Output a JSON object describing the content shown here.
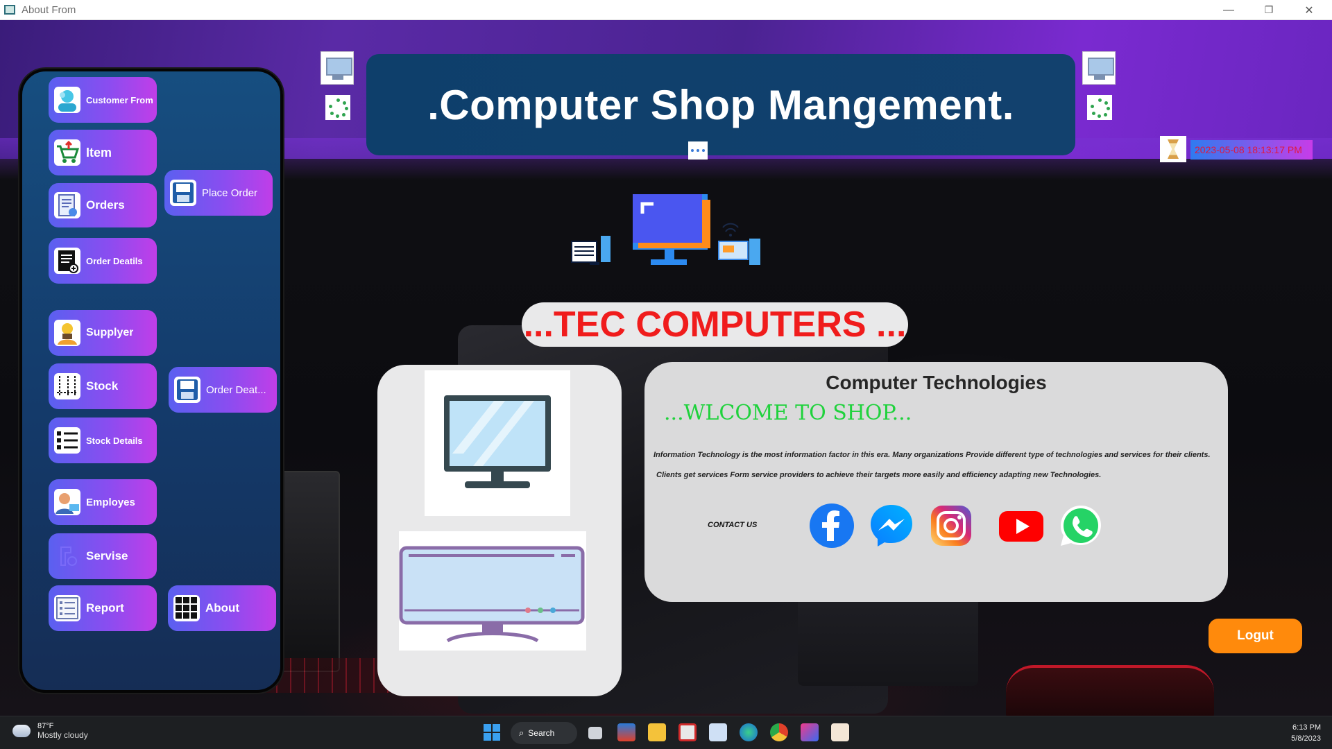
{
  "window": {
    "title": "About From",
    "controls": {
      "minimize": "—",
      "restore": "❐",
      "close": "✕"
    }
  },
  "sidebar": {
    "buttons": [
      {
        "id": "customer",
        "label": "Customer From",
        "icon": "customer-icon"
      },
      {
        "id": "item",
        "label": "Item",
        "icon": "cart-icon"
      },
      {
        "id": "orders",
        "label": "Orders",
        "icon": "document-icon"
      },
      {
        "id": "order-details",
        "label": "Order Deatils",
        "icon": "invoice-icon"
      },
      {
        "id": "place-order",
        "label": "Place Order",
        "icon": "floppy-icon"
      },
      {
        "id": "supplyer",
        "label": "Supplyer",
        "icon": "person-icon"
      },
      {
        "id": "stock",
        "label": "Stock",
        "icon": "stock-icon"
      },
      {
        "id": "order-deat",
        "label": "Order Deat...",
        "icon": "floppy-icon"
      },
      {
        "id": "stock-details",
        "label": "Stock Details",
        "icon": "list-icon"
      },
      {
        "id": "employes",
        "label": "Employes",
        "icon": "employee-icon"
      },
      {
        "id": "servise",
        "label": "Servise",
        "icon": "service-icon"
      },
      {
        "id": "report",
        "label": "Report",
        "icon": "report-icon"
      },
      {
        "id": "about",
        "label": "About",
        "icon": "grid-icon"
      }
    ]
  },
  "header": {
    "title": ".Computer Shop Mangement.",
    "datetime": "2023-05-08  18:13:17 PM"
  },
  "hero": {
    "brand": "...TEC COMPUTERS ..."
  },
  "info_card": {
    "title": "Computer Technologies",
    "welcome": "...WLCOME TO SHOP...",
    "line1": "Information Technology is the most information factor in this era.  Many organizations Provide different type of technologies and services for their clients.",
    "line2": "Clients get services Form service providers to achieve their targets more easily and efficiency adapting new Technologies.",
    "contact_label": "CONTACT US",
    "social": [
      "facebook-icon",
      "messenger-icon",
      "instagram-icon",
      "youtube-icon",
      "whatsapp-icon"
    ]
  },
  "actions": {
    "logout": "Logut"
  },
  "taskbar": {
    "weather_temp": "87°F",
    "weather_desc": "Mostly cloudy",
    "search": "Search",
    "time": "6:13 PM",
    "date": "5/8/2023"
  },
  "colors": {
    "accent_gradient_start": "#5a60f0",
    "accent_gradient_end": "#c03ee8",
    "brand_red": "#f01c1c",
    "welcome_green": "#1fd23c",
    "logout_orange": "#ff8a0c"
  }
}
